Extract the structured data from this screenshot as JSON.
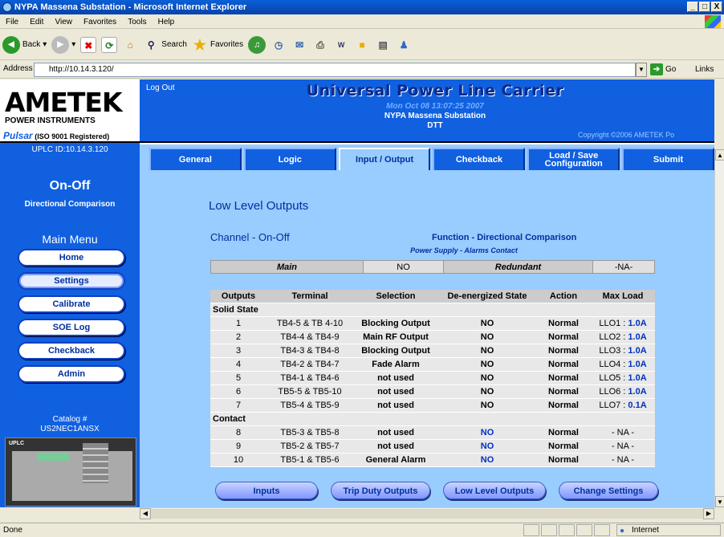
{
  "window": {
    "title": "NYPA Massena Substation - Microsoft Internet Explorer",
    "minimize": "_",
    "restore": "□",
    "close": "X"
  },
  "menu": [
    "File",
    "Edit",
    "View",
    "Favorites",
    "Tools",
    "Help"
  ],
  "toolbar": {
    "back": "Back",
    "search": "Search",
    "favorites": "Favorites"
  },
  "address": {
    "label": "Address",
    "url": "http://10.14.3.120/",
    "go": "Go",
    "links": "Links"
  },
  "left": {
    "brand": "AMETEK",
    "brand_sub": "POWER INSTRUMENTS",
    "pulsar": "Pulsar",
    "iso": "(ISO 9001 Registered)",
    "uplc_id": "UPLC ID:10.14.3.120",
    "mode": "On-Off",
    "scheme": "Directional Comparison",
    "menu_title": "Main Menu",
    "nav": [
      "Home",
      "Settings",
      "Calibrate",
      "SOE Log",
      "Checkback",
      "Admin"
    ],
    "catalog_label": "Catalog #",
    "catalog": "US2NEC1ANSX",
    "device_label": "UPLC"
  },
  "header": {
    "logout": "Log Out",
    "title": "Universal Power Line Carrier",
    "date": "Mon Oct 08 13:07:25 2007",
    "site": "NYPA Massena Substation",
    "dtt": "DTT",
    "copyright": "Copyright ©2006 AMETEK Po"
  },
  "tabs": [
    {
      "label": "General"
    },
    {
      "label": "Logic"
    },
    {
      "label": "Input / Output"
    },
    {
      "label": "Checkback"
    },
    {
      "label": "Load / Save Configuration"
    },
    {
      "label": "Submit"
    }
  ],
  "page": {
    "title": "Low Level Outputs",
    "channel": "Channel - On-Off",
    "function": "Function - Directional Comparison",
    "psac": "Power Supply - Alarms Contact",
    "redundancy": {
      "main_label": "Main",
      "main_value": "NO",
      "redundant_label": "Redundant",
      "redundant_value": "-NA-"
    },
    "columns": [
      "Outputs",
      "Terminal",
      "Selection",
      "De-energized State",
      "Action",
      "Max Load"
    ],
    "solid_state_label": "Solid State",
    "contact_label": "Contact",
    "solid_state": [
      {
        "n": "1",
        "term": "TB4-5 & TB 4-10",
        "sel": "Blocking Output",
        "state": "NO",
        "action": "Normal",
        "llo": "LLO1 : ",
        "load": "1.0A"
      },
      {
        "n": "2",
        "term": "TB4-4 & TB4-9",
        "sel": "Main RF Output",
        "state": "NO",
        "action": "Normal",
        "llo": "LLO2 : ",
        "load": "1.0A"
      },
      {
        "n": "3",
        "term": "TB4-3 & TB4-8",
        "sel": "Blocking Output",
        "state": "NO",
        "action": "Normal",
        "llo": "LLO3 : ",
        "load": "1.0A"
      },
      {
        "n": "4",
        "term": "TB4-2 & TB4-7",
        "sel": "Fade Alarm",
        "state": "NO",
        "action": "Normal",
        "llo": "LLO4 : ",
        "load": "1.0A"
      },
      {
        "n": "5",
        "term": "TB4-1 & TB4-6",
        "sel": "not used",
        "state": "NO",
        "action": "Normal",
        "llo": "LLO5 : ",
        "load": "1.0A"
      },
      {
        "n": "6",
        "term": "TB5-5 & TB5-10",
        "sel": "not used",
        "state": "NO",
        "action": "Normal",
        "llo": "LLO6 : ",
        "load": "1.0A"
      },
      {
        "n": "7",
        "term": "TB5-4 & TB5-9",
        "sel": "not used",
        "state": "NO",
        "action": "Normal",
        "llo": "LLO7 : ",
        "load": "0.1A"
      }
    ],
    "contact": [
      {
        "n": "8",
        "term": "TB5-3 & TB5-8",
        "sel": "not used",
        "state": "NO",
        "action": "Normal",
        "max": "- NA -"
      },
      {
        "n": "9",
        "term": "TB5-2 & TB5-7",
        "sel": "not used",
        "state": "NO",
        "action": "Normal",
        "max": "- NA -"
      },
      {
        "n": "10",
        "term": "TB5-1 & TB5-6",
        "sel": "General Alarm",
        "state": "NO",
        "action": "Normal",
        "max": "- NA -"
      }
    ],
    "buttons": [
      "Inputs",
      "Trip Duty Outputs",
      "Low Level Outputs",
      "Change Settings"
    ]
  },
  "status": {
    "text": "Done",
    "zone": "Internet"
  },
  "colors": {
    "frame_blue": "#1060e0",
    "content_bg": "#99ccff",
    "title_blue": "#0030a0"
  }
}
